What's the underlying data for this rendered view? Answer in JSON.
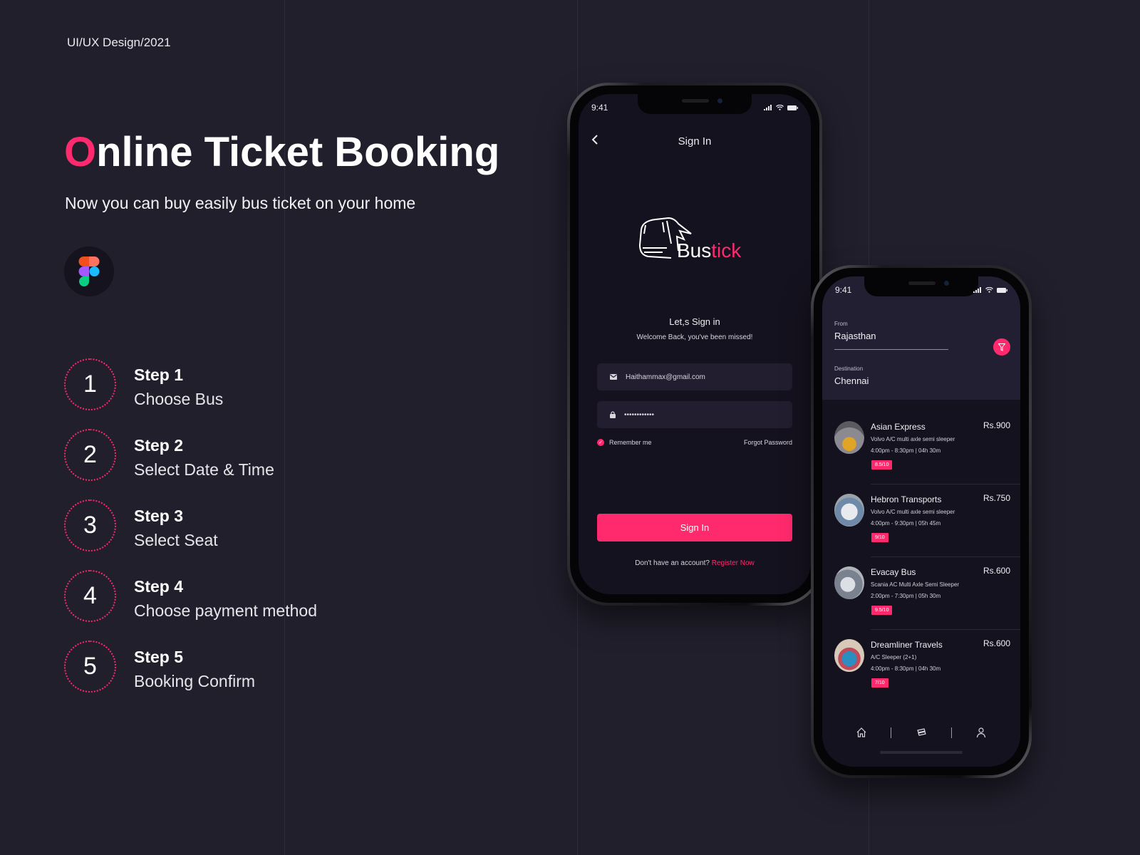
{
  "header": {
    "tag": "UI/UX Design/2021",
    "title_first_letter": "O",
    "title_rest": "nline Ticket Booking",
    "subtitle": "Now you can buy easily bus ticket on your home",
    "tool_icon": "figma-logo-icon"
  },
  "colors": {
    "background": "#211f2c",
    "accent": "#ff2a6d",
    "screen": "#15121f",
    "field": "#221e30"
  },
  "steps": [
    {
      "number": "1",
      "title": "Step 1",
      "desc": "Choose Bus"
    },
    {
      "number": "2",
      "title": "Step 2",
      "desc": "Select Date & Time"
    },
    {
      "number": "3",
      "title": "Step 3",
      "desc": "Select Seat"
    },
    {
      "number": "4",
      "title": "Step 4",
      "desc": "Choose payment method"
    },
    {
      "number": "5",
      "title": "Step 5",
      "desc": "Booking Confirm"
    }
  ],
  "signin_screen": {
    "time": "9:41",
    "header": "Sign In",
    "logo_prefix": "Bus",
    "logo_suffix": "tick",
    "heading": "Let,s Sign in",
    "welcome": "Welcome Back, you've been missed!",
    "email_value": "Haithammax@gmail.com",
    "password_value": "••••••••••••",
    "remember_label": "Remember me",
    "remember_checked": true,
    "forgot_label": "Forgot Password",
    "signin_button": "Sign In",
    "register_prompt": "Don't have an account?",
    "register_link": "Register Now"
  },
  "list_screen": {
    "time": "9:41",
    "from_label": "From",
    "from_value": "Rajasthan",
    "destination_label": "Destination",
    "destination_value": "Chennai",
    "buses": [
      {
        "name": "Asian Express",
        "type": "Volvo A/C multi axle semi sleeper",
        "time": "4:00pm - 8:30pm  |  04h 30m",
        "rating": "8.5/10",
        "price": "Rs.900"
      },
      {
        "name": "Hebron Transports",
        "type": "Volvo A/C multi axle semi sleeper",
        "time": "4:00pm - 9:30pm  |  05h 45m",
        "rating": "9/10",
        "price": "Rs.750"
      },
      {
        "name": "Evacay Bus",
        "type": "Scania AC Multi Axle Semi Sleeper",
        "time": "2:00pm - 7:30pm  |  05h 30m",
        "rating": "9.5/10",
        "price": "Rs.600"
      },
      {
        "name": "Dreamliner Travels",
        "type": "A/C Sleeper (2+1)",
        "time": "4:00pm - 8:30pm  |  04h 30m",
        "rating": "7/10",
        "price": "Rs.600"
      }
    ],
    "tabs": [
      "home-icon",
      "ticket-icon",
      "profile-icon"
    ]
  }
}
